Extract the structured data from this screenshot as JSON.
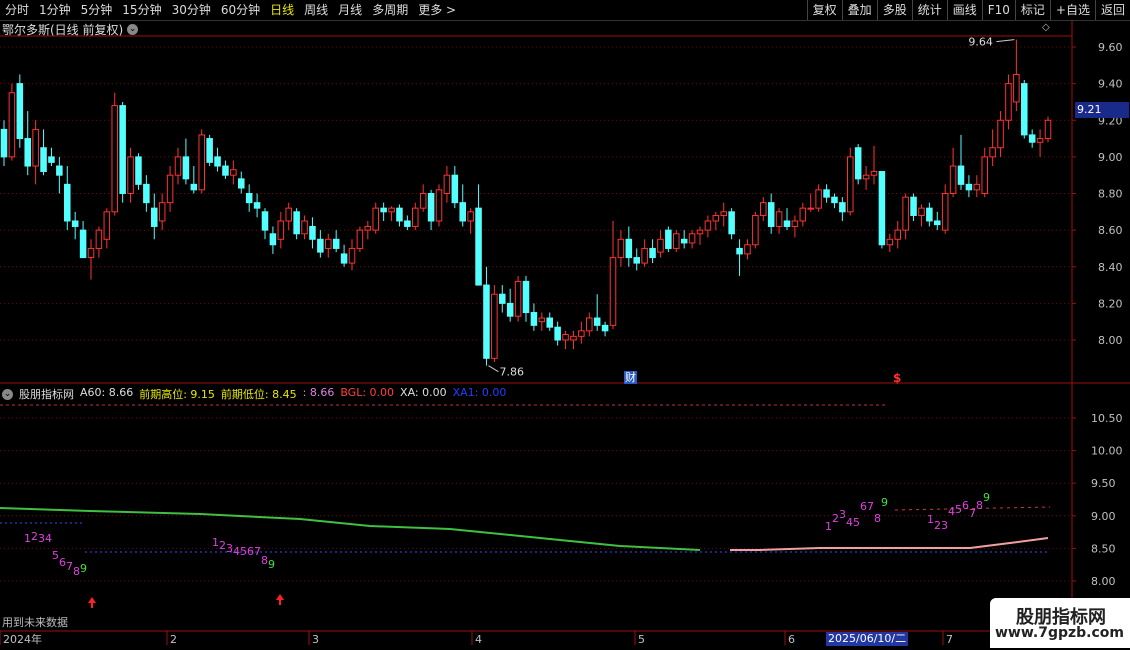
{
  "toolbar": {
    "periods": [
      "分时",
      "1分钟",
      "5分钟",
      "15分钟",
      "30分钟",
      "60分钟",
      "日线",
      "周线",
      "月线",
      "多周期",
      "更多 >"
    ],
    "active_period": "日线",
    "actions": [
      "复权",
      "叠加",
      "多股",
      "统计",
      "画线",
      "F10",
      "标记",
      "+自选",
      "返回"
    ]
  },
  "main_chart": {
    "title": "鄂尔多斯(日线 前复权)",
    "y_ticks": [
      "9.60",
      "9.40",
      "9.20",
      "9.00",
      "8.80",
      "8.60",
      "8.40",
      "8.20",
      "8.00"
    ],
    "current_price": "9.21",
    "high_label": "9.64",
    "low_label": "7.86",
    "cai_label": "财",
    "dollar_label": "$"
  },
  "indicator": {
    "name": "股朋指标网",
    "fields": [
      {
        "label": "A60:",
        "value": "8.66",
        "color": "#dddddd"
      },
      {
        "label": "前期高位:",
        "value": "9.15",
        "color": "#e8e800"
      },
      {
        "label": "前期低位:",
        "value": "8.45",
        "color": "#e8e800"
      },
      {
        "label": ":",
        "value": "8.66",
        "color": "#e080e0"
      },
      {
        "label": "BGL:",
        "value": "0.00",
        "color": "#ff4040"
      },
      {
        "label": "XA:",
        "value": "0.00",
        "color": "#dddddd"
      },
      {
        "label": "XA1:",
        "value": "0.00",
        "color": "#2040ff"
      }
    ],
    "y_ticks": [
      "10.50",
      "10.00",
      "9.50",
      "9.00",
      "8.50",
      "8.00"
    ],
    "note": "用到未来数据"
  },
  "x_axis": {
    "labels": [
      "2024年",
      "2",
      "3",
      "4",
      "5",
      "6",
      "7"
    ],
    "cursor_date": "2025/06/10/二"
  },
  "watermark": {
    "name": "股朋指标网",
    "url": "www.7gpzb.com"
  },
  "colors": {
    "up": "#ff3232",
    "down": "#54ffff",
    "grid": "#7a0000",
    "axis": "#9b1010"
  },
  "chart_data": {
    "type": "candlestick",
    "ylim": [
      7.8,
      9.7
    ],
    "candles": [
      {
        "o": 9.15,
        "h": 9.2,
        "l": 8.95,
        "c": 9.0
      },
      {
        "o": 9.0,
        "h": 9.4,
        "l": 8.98,
        "c": 9.35
      },
      {
        "o": 9.4,
        "h": 9.45,
        "l": 9.05,
        "c": 9.1
      },
      {
        "o": 9.1,
        "h": 9.25,
        "l": 8.9,
        "c": 8.95
      },
      {
        "o": 8.95,
        "h": 9.2,
        "l": 8.85,
        "c": 9.15
      },
      {
        "o": 9.05,
        "h": 9.15,
        "l": 8.9,
        "c": 8.92
      },
      {
        "o": 9.0,
        "h": 9.05,
        "l": 8.95,
        "c": 8.97
      },
      {
        "o": 8.95,
        "h": 9.0,
        "l": 8.8,
        "c": 8.9
      },
      {
        "o": 8.85,
        "h": 8.95,
        "l": 8.6,
        "c": 8.65
      },
      {
        "o": 8.65,
        "h": 8.7,
        "l": 8.55,
        "c": 8.62
      },
      {
        "o": 8.6,
        "h": 8.65,
        "l": 8.45,
        "c": 8.45
      },
      {
        "o": 8.45,
        "h": 8.55,
        "l": 8.33,
        "c": 8.5
      },
      {
        "o": 8.5,
        "h": 8.62,
        "l": 8.45,
        "c": 8.6
      },
      {
        "o": 8.55,
        "h": 8.72,
        "l": 8.5,
        "c": 8.7
      },
      {
        "o": 8.7,
        "h": 9.35,
        "l": 8.68,
        "c": 9.28
      },
      {
        "o": 9.28,
        "h": 9.3,
        "l": 8.75,
        "c": 8.8
      },
      {
        "o": 8.8,
        "h": 9.05,
        "l": 8.75,
        "c": 9.0
      },
      {
        "o": 9.0,
        "h": 9.02,
        "l": 8.82,
        "c": 8.85
      },
      {
        "o": 8.85,
        "h": 8.9,
        "l": 8.7,
        "c": 8.75
      },
      {
        "o": 8.72,
        "h": 8.8,
        "l": 8.55,
        "c": 8.62
      },
      {
        "o": 8.65,
        "h": 8.8,
        "l": 8.6,
        "c": 8.75
      },
      {
        "o": 8.75,
        "h": 8.95,
        "l": 8.7,
        "c": 8.9
      },
      {
        "o": 8.9,
        "h": 9.05,
        "l": 8.85,
        "c": 9.0
      },
      {
        "o": 9.0,
        "h": 9.1,
        "l": 8.85,
        "c": 8.88
      },
      {
        "o": 8.85,
        "h": 8.95,
        "l": 8.8,
        "c": 8.82
      },
      {
        "o": 8.82,
        "h": 9.15,
        "l": 8.8,
        "c": 9.12
      },
      {
        "o": 9.1,
        "h": 9.12,
        "l": 8.95,
        "c": 8.97
      },
      {
        "o": 9.0,
        "h": 9.05,
        "l": 8.92,
        "c": 8.95
      },
      {
        "o": 8.95,
        "h": 8.98,
        "l": 8.88,
        "c": 8.9
      },
      {
        "o": 8.9,
        "h": 8.98,
        "l": 8.85,
        "c": 8.93
      },
      {
        "o": 8.88,
        "h": 8.92,
        "l": 8.8,
        "c": 8.83
      },
      {
        "o": 8.8,
        "h": 8.85,
        "l": 8.7,
        "c": 8.75
      },
      {
        "o": 8.75,
        "h": 8.8,
        "l": 8.67,
        "c": 8.72
      },
      {
        "o": 8.7,
        "h": 8.72,
        "l": 8.55,
        "c": 8.6
      },
      {
        "o": 8.58,
        "h": 8.62,
        "l": 8.47,
        "c": 8.52
      },
      {
        "o": 8.55,
        "h": 8.7,
        "l": 8.5,
        "c": 8.65
      },
      {
        "o": 8.65,
        "h": 8.75,
        "l": 8.6,
        "c": 8.72
      },
      {
        "o": 8.7,
        "h": 8.72,
        "l": 8.55,
        "c": 8.58
      },
      {
        "o": 8.58,
        "h": 8.68,
        "l": 8.55,
        "c": 8.65
      },
      {
        "o": 8.62,
        "h": 8.67,
        "l": 8.5,
        "c": 8.55
      },
      {
        "o": 8.55,
        "h": 8.6,
        "l": 8.45,
        "c": 8.48
      },
      {
        "o": 8.5,
        "h": 8.58,
        "l": 8.45,
        "c": 8.55
      },
      {
        "o": 8.55,
        "h": 8.6,
        "l": 8.48,
        "c": 8.5
      },
      {
        "o": 8.47,
        "h": 8.52,
        "l": 8.4,
        "c": 8.42
      },
      {
        "o": 8.42,
        "h": 8.55,
        "l": 8.38,
        "c": 8.5
      },
      {
        "o": 8.5,
        "h": 8.62,
        "l": 8.48,
        "c": 8.6
      },
      {
        "o": 8.6,
        "h": 8.65,
        "l": 8.55,
        "c": 8.62
      },
      {
        "o": 8.6,
        "h": 8.75,
        "l": 8.58,
        "c": 8.72
      },
      {
        "o": 8.72,
        "h": 8.75,
        "l": 8.65,
        "c": 8.7
      },
      {
        "o": 8.7,
        "h": 8.73,
        "l": 8.65,
        "c": 8.72
      },
      {
        "o": 8.72,
        "h": 8.74,
        "l": 8.62,
        "c": 8.65
      },
      {
        "o": 8.65,
        "h": 8.68,
        "l": 8.6,
        "c": 8.62
      },
      {
        "o": 8.62,
        "h": 8.75,
        "l": 8.6,
        "c": 8.72
      },
      {
        "o": 8.72,
        "h": 8.85,
        "l": 8.7,
        "c": 8.8
      },
      {
        "o": 8.8,
        "h": 8.82,
        "l": 8.6,
        "c": 8.65
      },
      {
        "o": 8.65,
        "h": 8.85,
        "l": 8.62,
        "c": 8.82
      },
      {
        "o": 8.8,
        "h": 8.95,
        "l": 8.75,
        "c": 8.9
      },
      {
        "o": 8.9,
        "h": 8.95,
        "l": 8.72,
        "c": 8.75
      },
      {
        "o": 8.75,
        "h": 8.85,
        "l": 8.62,
        "c": 8.65
      },
      {
        "o": 8.65,
        "h": 8.72,
        "l": 8.58,
        "c": 8.7
      },
      {
        "o": 8.72,
        "h": 8.85,
        "l": 8.3,
        "c": 8.3
      },
      {
        "o": 8.3,
        "h": 8.4,
        "l": 7.86,
        "c": 7.9
      },
      {
        "o": 7.9,
        "h": 8.3,
        "l": 7.88,
        "c": 8.25
      },
      {
        "o": 8.25,
        "h": 8.3,
        "l": 8.15,
        "c": 8.2
      },
      {
        "o": 8.2,
        "h": 8.28,
        "l": 8.1,
        "c": 8.13
      },
      {
        "o": 8.13,
        "h": 8.35,
        "l": 8.1,
        "c": 8.32
      },
      {
        "o": 8.32,
        "h": 8.35,
        "l": 8.1,
        "c": 8.15
      },
      {
        "o": 8.15,
        "h": 8.2,
        "l": 8.05,
        "c": 8.08
      },
      {
        "o": 8.1,
        "h": 8.15,
        "l": 8.05,
        "c": 8.12
      },
      {
        "o": 8.12,
        "h": 8.15,
        "l": 8.05,
        "c": 8.07
      },
      {
        "o": 8.07,
        "h": 8.1,
        "l": 7.97,
        "c": 8.0
      },
      {
        "o": 8.0,
        "h": 8.05,
        "l": 7.95,
        "c": 8.03
      },
      {
        "o": 8.0,
        "h": 8.05,
        "l": 7.95,
        "c": 8.02
      },
      {
        "o": 8.02,
        "h": 8.1,
        "l": 7.98,
        "c": 8.05
      },
      {
        "o": 8.05,
        "h": 8.15,
        "l": 8.02,
        "c": 8.12
      },
      {
        "o": 8.12,
        "h": 8.25,
        "l": 8.05,
        "c": 8.08
      },
      {
        "o": 8.08,
        "h": 8.1,
        "l": 8.02,
        "c": 8.05
      },
      {
        "o": 8.08,
        "h": 8.65,
        "l": 8.06,
        "c": 8.45
      },
      {
        "o": 8.45,
        "h": 8.6,
        "l": 8.4,
        "c": 8.55
      },
      {
        "o": 8.55,
        "h": 8.62,
        "l": 8.4,
        "c": 8.45
      },
      {
        "o": 8.45,
        "h": 8.5,
        "l": 8.38,
        "c": 8.42
      },
      {
        "o": 8.42,
        "h": 8.55,
        "l": 8.4,
        "c": 8.5
      },
      {
        "o": 8.5,
        "h": 8.55,
        "l": 8.42,
        "c": 8.45
      },
      {
        "o": 8.48,
        "h": 8.6,
        "l": 8.45,
        "c": 8.55
      },
      {
        "o": 8.6,
        "h": 8.62,
        "l": 8.48,
        "c": 8.5
      },
      {
        "o": 8.5,
        "h": 8.6,
        "l": 8.48,
        "c": 8.58
      },
      {
        "o": 8.55,
        "h": 8.6,
        "l": 8.5,
        "c": 8.53
      },
      {
        "o": 8.53,
        "h": 8.6,
        "l": 8.5,
        "c": 8.58
      },
      {
        "o": 8.58,
        "h": 8.62,
        "l": 8.52,
        "c": 8.6
      },
      {
        "o": 8.6,
        "h": 8.68,
        "l": 8.56,
        "c": 8.65
      },
      {
        "o": 8.65,
        "h": 8.7,
        "l": 8.6,
        "c": 8.68
      },
      {
        "o": 8.68,
        "h": 8.75,
        "l": 8.62,
        "c": 8.7
      },
      {
        "o": 8.7,
        "h": 8.72,
        "l": 8.55,
        "c": 8.58
      },
      {
        "o": 8.5,
        "h": 8.55,
        "l": 8.35,
        "c": 8.47
      },
      {
        "o": 8.47,
        "h": 8.55,
        "l": 8.44,
        "c": 8.52
      },
      {
        "o": 8.52,
        "h": 8.7,
        "l": 8.5,
        "c": 8.68
      },
      {
        "o": 8.68,
        "h": 8.78,
        "l": 8.65,
        "c": 8.75
      },
      {
        "o": 8.75,
        "h": 8.8,
        "l": 8.58,
        "c": 8.62
      },
      {
        "o": 8.62,
        "h": 8.72,
        "l": 8.58,
        "c": 8.7
      },
      {
        "o": 8.65,
        "h": 8.72,
        "l": 8.6,
        "c": 8.62
      },
      {
        "o": 8.62,
        "h": 8.68,
        "l": 8.56,
        "c": 8.65
      },
      {
        "o": 8.65,
        "h": 8.75,
        "l": 8.62,
        "c": 8.72
      },
      {
        "o": 8.72,
        "h": 8.8,
        "l": 8.7,
        "c": 8.72
      },
      {
        "o": 8.72,
        "h": 8.85,
        "l": 8.7,
        "c": 8.82
      },
      {
        "o": 8.82,
        "h": 8.85,
        "l": 8.75,
        "c": 8.78
      },
      {
        "o": 8.78,
        "h": 8.8,
        "l": 8.72,
        "c": 8.75
      },
      {
        "o": 8.75,
        "h": 8.78,
        "l": 8.65,
        "c": 8.7
      },
      {
        "o": 8.7,
        "h": 9.05,
        "l": 8.68,
        "c": 9.0
      },
      {
        "o": 9.05,
        "h": 9.07,
        "l": 8.85,
        "c": 8.88
      },
      {
        "o": 8.88,
        "h": 8.95,
        "l": 8.82,
        "c": 8.9
      },
      {
        "o": 8.9,
        "h": 9.06,
        "l": 8.85,
        "c": 8.92
      },
      {
        "o": 8.92,
        "h": 8.92,
        "l": 8.5,
        "c": 8.52
      },
      {
        "o": 8.52,
        "h": 8.58,
        "l": 8.48,
        "c": 8.55
      },
      {
        "o": 8.55,
        "h": 8.65,
        "l": 8.5,
        "c": 8.6
      },
      {
        "o": 8.6,
        "h": 8.8,
        "l": 8.55,
        "c": 8.78
      },
      {
        "o": 8.78,
        "h": 8.8,
        "l": 8.65,
        "c": 8.68
      },
      {
        "o": 8.68,
        "h": 8.74,
        "l": 8.62,
        "c": 8.72
      },
      {
        "o": 8.72,
        "h": 8.75,
        "l": 8.62,
        "c": 8.65
      },
      {
        "o": 8.65,
        "h": 8.7,
        "l": 8.6,
        "c": 8.63
      },
      {
        "o": 8.6,
        "h": 8.85,
        "l": 8.58,
        "c": 8.8
      },
      {
        "o": 8.8,
        "h": 9.05,
        "l": 8.78,
        "c": 8.95
      },
      {
        "o": 8.95,
        "h": 9.12,
        "l": 8.82,
        "c": 8.85
      },
      {
        "o": 8.85,
        "h": 8.9,
        "l": 8.78,
        "c": 8.82
      },
      {
        "o": 8.82,
        "h": 8.9,
        "l": 8.78,
        "c": 8.85
      },
      {
        "o": 8.8,
        "h": 9.05,
        "l": 8.78,
        "c": 9.0
      },
      {
        "o": 9.0,
        "h": 9.15,
        "l": 8.95,
        "c": 9.05
      },
      {
        "o": 9.05,
        "h": 9.25,
        "l": 9.0,
        "c": 9.2
      },
      {
        "o": 9.2,
        "h": 9.45,
        "l": 9.15,
        "c": 9.4
      },
      {
        "o": 9.3,
        "h": 9.64,
        "l": 9.25,
        "c": 9.45
      },
      {
        "o": 9.4,
        "h": 9.42,
        "l": 9.1,
        "c": 9.12
      },
      {
        "o": 9.12,
        "h": 9.15,
        "l": 9.05,
        "c": 9.08
      },
      {
        "o": 9.08,
        "h": 9.15,
        "l": 9.0,
        "c": 9.1
      },
      {
        "o": 9.1,
        "h": 9.22,
        "l": 9.08,
        "c": 9.2
      }
    ]
  }
}
